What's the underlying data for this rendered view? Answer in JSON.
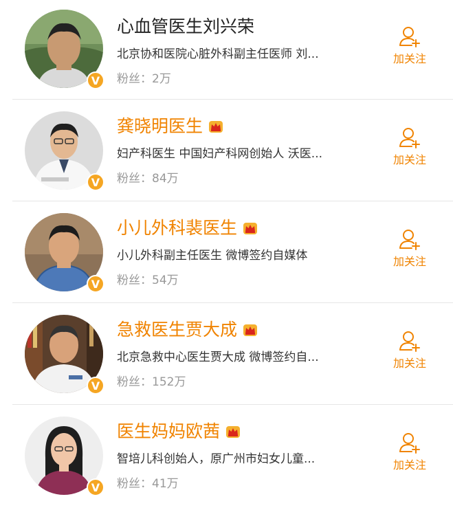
{
  "accent_color": "#f08300",
  "verified_badge_color": "#f5a623",
  "follow_icon": "add-user-icon",
  "crown_icon": "vip-crown-icon",
  "verified_badge": {
    "icon": "verified-v-icon",
    "glyph": "V"
  },
  "users": [
    {
      "name": "心血管医生刘兴荣",
      "description": "北京协和医院心脏外科副主任医师 刘...",
      "fans_label": "粉丝：",
      "fans_count": "2万",
      "follow_label": "加关注",
      "vip": false
    },
    {
      "name": "龚晓明医生",
      "description": "妇产科医生 中国妇产科网创始人 沃医...",
      "fans_label": "粉丝：",
      "fans_count": "84万",
      "follow_label": "加关注",
      "vip": true
    },
    {
      "name": "小儿外科裴医生",
      "description": "小儿外科副主任医生 微博签约自媒体",
      "fans_label": "粉丝：",
      "fans_count": "54万",
      "follow_label": "加关注",
      "vip": true
    },
    {
      "name": "急救医生贾大成",
      "description": "北京急救中心医生贾大成 微博签约自...",
      "fans_label": "粉丝：",
      "fans_count": "152万",
      "follow_label": "加关注",
      "vip": true
    },
    {
      "name": "医生妈妈欧茜",
      "description": "智培儿科创始人，原广州市妇女儿童...",
      "fans_label": "粉丝：",
      "fans_count": "41万",
      "follow_label": "加关注",
      "vip": true
    }
  ]
}
